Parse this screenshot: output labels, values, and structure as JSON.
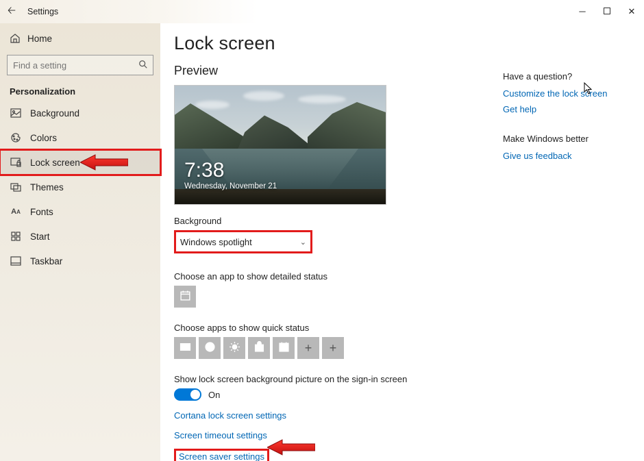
{
  "window": {
    "title": "Settings"
  },
  "sidebar": {
    "home": "Home",
    "search_placeholder": "Find a setting",
    "section": "Personalization",
    "items": [
      {
        "label": "Background"
      },
      {
        "label": "Colors"
      },
      {
        "label": "Lock screen"
      },
      {
        "label": "Themes"
      },
      {
        "label": "Fonts"
      },
      {
        "label": "Start"
      },
      {
        "label": "Taskbar"
      }
    ]
  },
  "page": {
    "title": "Lock screen",
    "preview_label": "Preview",
    "clock_time": "7:38",
    "clock_date": "Wednesday, November 21",
    "background_label": "Background",
    "background_value": "Windows spotlight",
    "detailed_label": "Choose an app to show detailed status",
    "quick_label": "Choose apps to show quick status",
    "signin_label": "Show lock screen background picture on the sign-in screen",
    "toggle_state": "On",
    "link_cortana": "Cortana lock screen settings",
    "link_timeout": "Screen timeout settings",
    "link_saver": "Screen saver settings"
  },
  "aside": {
    "question": "Have a question?",
    "link_customize": "Customize the lock screen",
    "link_help": "Get help",
    "better": "Make Windows better",
    "link_feedback": "Give us feedback"
  }
}
